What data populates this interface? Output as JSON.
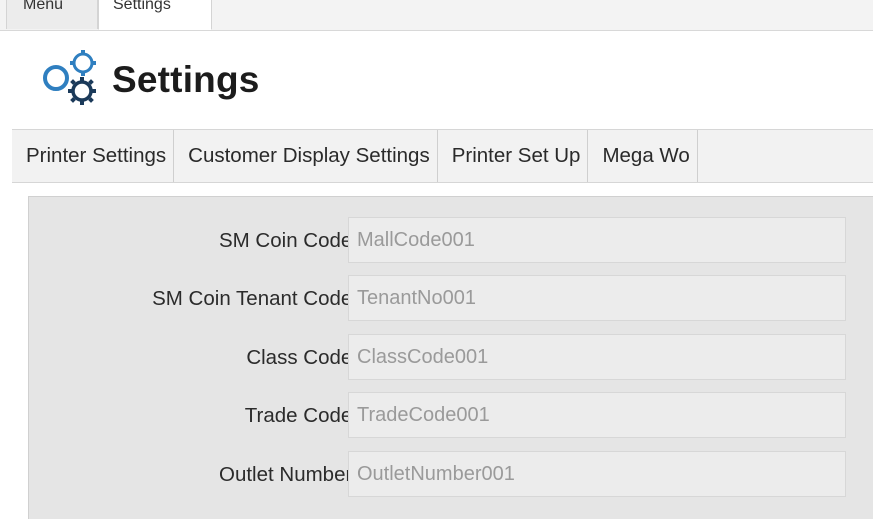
{
  "window_tabs": {
    "menu": "Menu",
    "settings": "Settings"
  },
  "header": {
    "title": "Settings",
    "icon": "gears-icon",
    "icon_color": "#2f7fc0"
  },
  "tabs": [
    {
      "label": "Printer Settings"
    },
    {
      "label": "Customer Display Settings"
    },
    {
      "label": "Printer Set Up"
    },
    {
      "label": "Mega Wo"
    }
  ],
  "form": {
    "fields": [
      {
        "label": "SM Coin Code:",
        "value": "MallCode001"
      },
      {
        "label": "SM Coin Tenant Code:",
        "value": "TenantNo001"
      },
      {
        "label": "Class Code:",
        "value": "ClassCode001"
      },
      {
        "label": "Trade Code:",
        "value": "TradeCode001"
      },
      {
        "label": "Outlet Number:",
        "value": "OutletNumber001"
      }
    ]
  }
}
